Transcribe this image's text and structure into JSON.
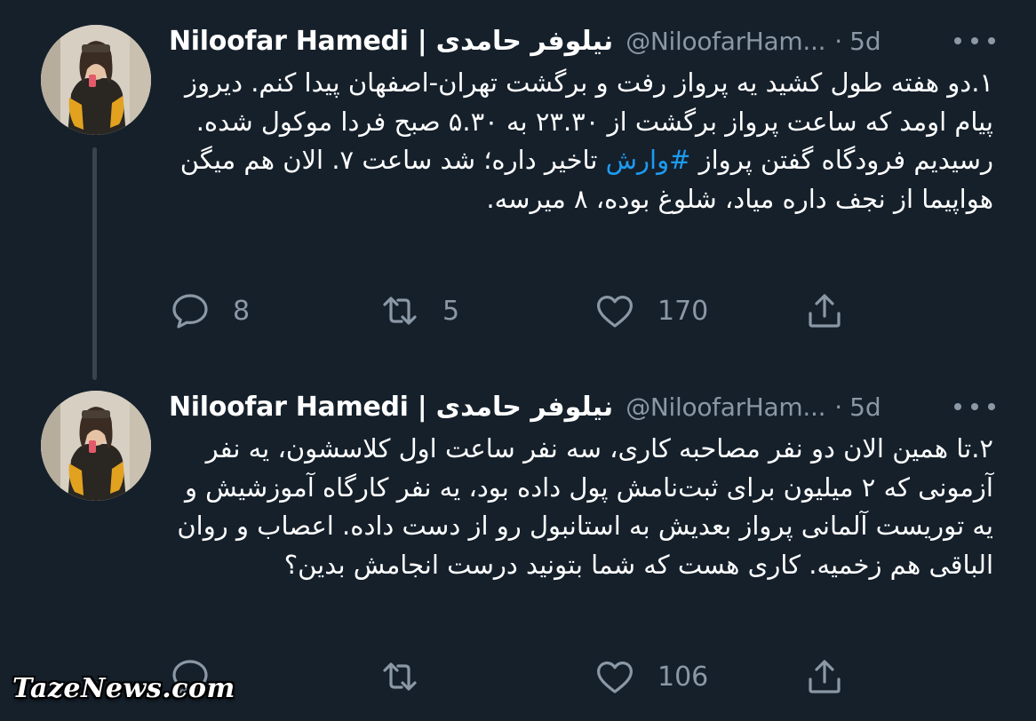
{
  "tweets": [
    {
      "display_name": "Niloofar Hamedi | نیلوفر حامدی",
      "handle": "@NiloofarHam...",
      "separator": "·",
      "time": "5d",
      "text_before_hashtag": "۱.دو هفته طول کشید یه پرواز رفت و برگشت تهران-اصفهان پیدا کنم. دیروز پیام اومد که ساعت پرواز برگشت از ۲۳.۳۰ به ۵.۳۰ صبح فردا موکول شده. رسیدیم فرودگاه گفتن پرواز ",
      "hashtag": "#وارش",
      "text_after_hashtag": " تاخیر داره؛ شد ساعت ۷. الان هم میگن هواپیما از نجف داره میاد، شلوغ بوده، ۸ میرسه.",
      "replies": "8",
      "retweets": "5",
      "likes": "170"
    },
    {
      "display_name": "Niloofar Hamedi | نیلوفر حامدی",
      "handle": "@NiloofarHam...",
      "separator": "·",
      "time": "5d",
      "text": "۲.تا همین الان دو نفر مصاحبه کاری، سه نفر ساعت اول کلاسشون، یه نفر آزمونی که ۲ میلیون برای ثبت‌نامش پول داده بود، یه نفر کارگاه آموزشیش و یه توریست آلمانی پرواز بعدیش به استانبول رو از دست داده. اعصاب و روان الباقی هم زخمیه. کاری هست که شما بتونید درست انجامش بدین؟",
      "replies": "",
      "retweets": "",
      "likes": "106"
    }
  ],
  "icons": [
    "reply-icon",
    "retweet-icon",
    "like-icon",
    "share-icon",
    "more-icon"
  ],
  "colors": {
    "background": "#15202b",
    "secondary_text": "#8b98a5",
    "hashtag": "#1d9bf0",
    "thread_line": "#38444d"
  },
  "watermark": "TazeNews.com"
}
